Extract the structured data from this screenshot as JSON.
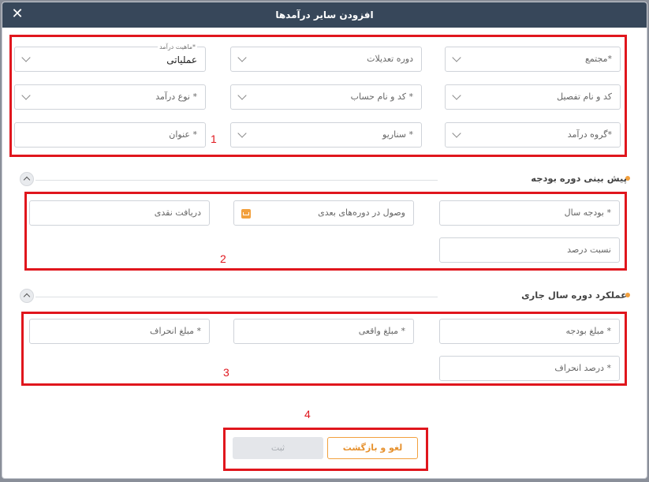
{
  "dialog": {
    "title": "افزودن سایر درآمدها",
    "close_glyph": "✕"
  },
  "section1": {
    "complex": "مجتمع*",
    "adjust_period": "دوره تعدیلات",
    "income_nature_label": "ماهیت درآمد*",
    "income_nature_value": "عملیاتی",
    "detail_code_name": "کد و نام تفصیل",
    "account_code_name": "کد و نام حساب *",
    "income_type": "نوع درآمد *",
    "income_group": "گروه درآمد*",
    "scenario": "سناریو *",
    "title_field": "عنوان *"
  },
  "budget_forecast": {
    "heading": "پیش بینی دوره بودجه",
    "year_budget": "بودجه سال *",
    "collection_later": "وصول در دوره‌های بعدی",
    "cash_receipt": "دریافت نقدی",
    "percent_ratio": "نسبت درصد"
  },
  "current_year": {
    "heading": "عملکرد دوره سال جاری",
    "budget_amount": "مبلغ بودجه *",
    "actual_amount": "مبلغ واقعی *",
    "deviation_amount": "مبلغ انحراف *",
    "deviation_percent": "درصد انحراف *"
  },
  "footer": {
    "submit": "ثبت",
    "cancel": "لغو و بازگشت"
  },
  "annotations": {
    "n1": "1",
    "n2": "2",
    "n3": "3",
    "n4": "4"
  },
  "colors": {
    "header": "#37475a",
    "accent": "#f2a03d",
    "annotation": "#e0161d"
  },
  "icons": {
    "close": "close-icon",
    "collapse": "chevron-up-icon",
    "dropdown": "chevron-down-icon",
    "collection": "inbox-icon"
  }
}
